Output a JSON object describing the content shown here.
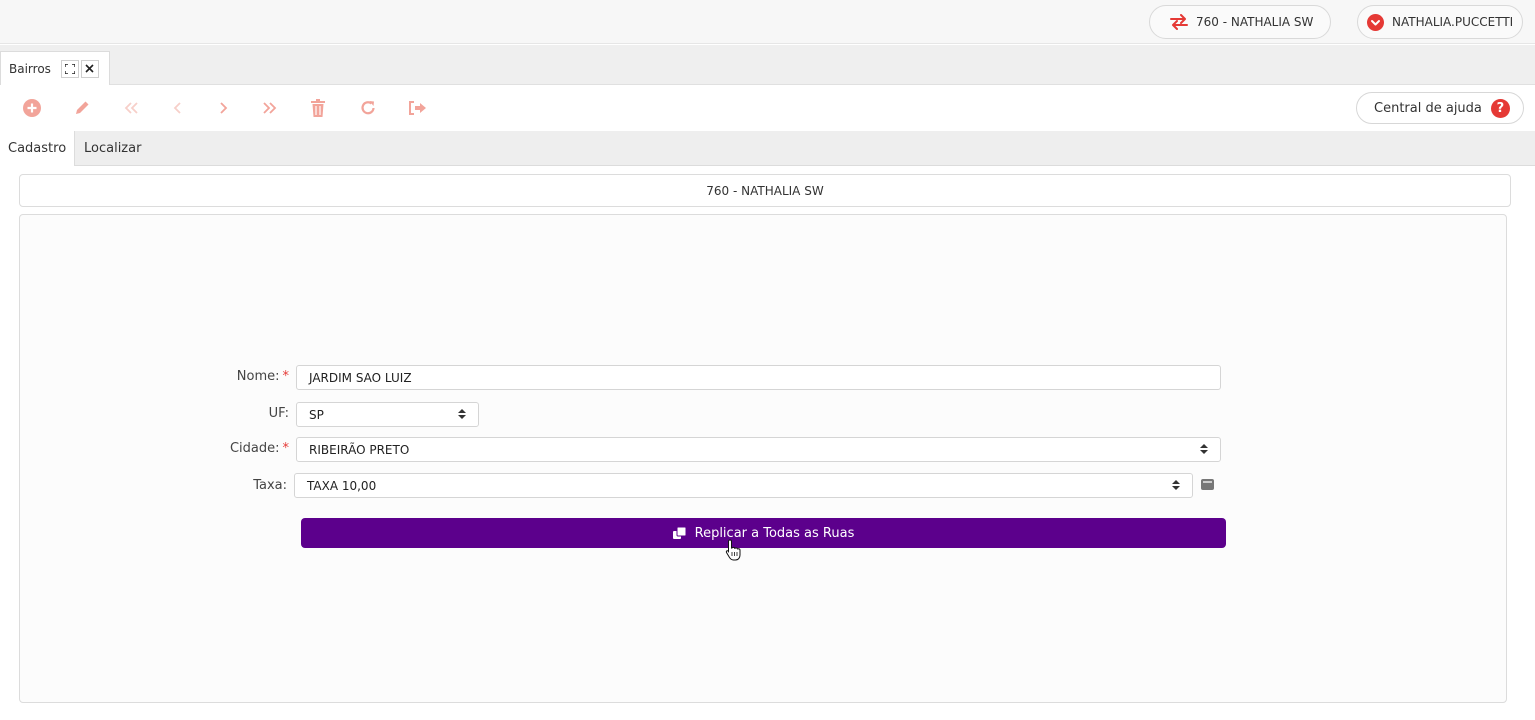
{
  "header": {
    "company": "760 - NATHALIA SW",
    "user": "NATHALIA.PUCCETTI",
    "company_icon": "swap-arrows-icon",
    "user_icon": "chevron-down-circle-icon"
  },
  "tabs": [
    {
      "label": "Bairros"
    }
  ],
  "toolbar": {
    "icons": [
      "add-icon",
      "edit-icon",
      "first-record-icon",
      "previous-record-icon",
      "next-record-icon",
      "last-record-icon",
      "delete-icon",
      "refresh-icon",
      "exit-icon"
    ],
    "help_label": "Central de ajuda",
    "help_glyph": "?",
    "icon_color": "#f2a49a"
  },
  "subtabs": [
    "Cadastro",
    "Localizar"
  ],
  "banner": "760 - NATHALIA SW",
  "form": {
    "nome_label": "Nome:",
    "nome_value": "JARDIM SAO LUIZ",
    "uf_label": "UF:",
    "uf_value": "SP",
    "cidade_label": "Cidade:",
    "cidade_value": "RIBEIRÃO PRETO",
    "taxa_label": "Taxa:",
    "taxa_value": "TAXA 10,00",
    "required_mark": "*"
  },
  "replicate_button": "Replicar a Todas as Ruas",
  "colors": {
    "accent": "#5c008c",
    "danger": "#e53935",
    "toolbar_icon": "#f2a49a"
  }
}
